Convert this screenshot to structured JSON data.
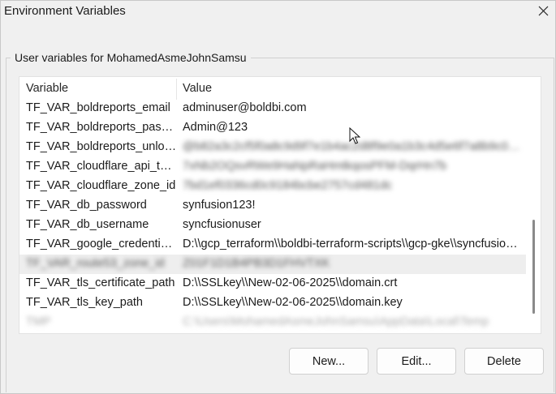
{
  "window": {
    "title": "Environment Variables",
    "close_icon": "close-icon"
  },
  "user_group": {
    "legend": "User variables for MohamedAsmeJohnSamsu"
  },
  "table": {
    "columns": [
      "Variable",
      "Value"
    ],
    "rows": [
      {
        "variable": "TF_VAR_boldreports_email",
        "value": "adminuser@boldbi.com",
        "blurred": false
      },
      {
        "variable": "TF_VAR_boldreports_password",
        "value": "Admin@123",
        "blurred": false
      },
      {
        "variable": "TF_VAR_boldreports_unlock_key",
        "value": "@b82a3c2cf5f0a8c9d9f7e1b4ac2d8f9e0a1b3c4d5e6f7a8b9c0d1e2f3a4b5c6d7e8",
        "blurred": true
      },
      {
        "variable": "TF_VAR_cloudflare_api_token",
        "value": "7xNb2OQsvRWe9HaNpRaHmtkqosPFM-DqrHn7b",
        "blurred": true
      },
      {
        "variable": "TF_VAR_cloudflare_zone_id",
        "value": "7bd1ef0336cd0c9184bcbe2757cd481dc",
        "blurred": true
      },
      {
        "variable": "TF_VAR_db_password",
        "value": "synfusion123!",
        "blurred": false
      },
      {
        "variable": "TF_VAR_db_username",
        "value": "syncfusionuser",
        "blurred": false
      },
      {
        "variable": "TF_VAR_google_credentials_path",
        "value": "D:\\\\gcp_terraform\\\\boldbi-terraform-scripts\\\\gcp-gke\\\\syncfusion-credentials.json",
        "blurred": false
      },
      {
        "variable": "TF_VAR_route53_zone_id",
        "value": "Z01F1D1B4PB3D1FHVTXK",
        "blurred": true,
        "highlight": true
      },
      {
        "variable": "TF_VAR_tls_certificate_path",
        "value": "D:\\\\SSLkey\\\\New-02-06-2025\\\\domain.crt",
        "blurred": false
      },
      {
        "variable": "TF_VAR_tls_key_path",
        "value": "D:\\\\SSLkey\\\\New-02-06-2025\\\\domain.key",
        "blurred": false
      },
      {
        "variable": "TMP",
        "value": "C:\\Users\\MohamedAsmeJohnSamsu\\AppData\\Local\\Temp",
        "blurred": true,
        "faded": true
      }
    ]
  },
  "buttons": {
    "new": "New...",
    "edit": "Edit...",
    "delete": "Delete"
  }
}
